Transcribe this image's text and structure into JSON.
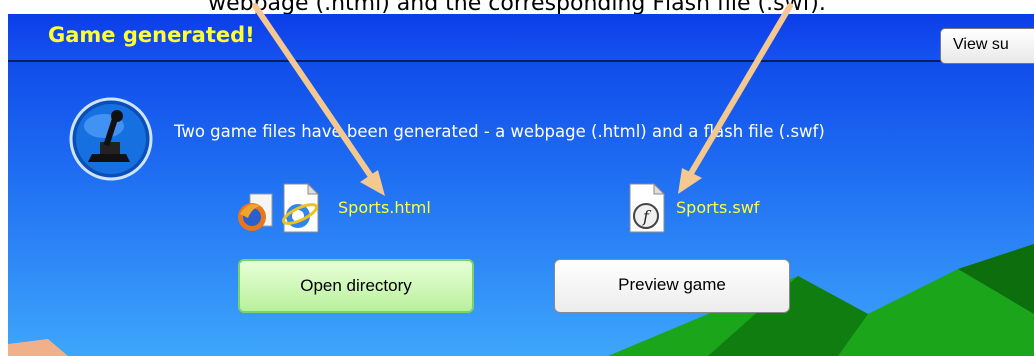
{
  "caption": "webpage (.html) and the corresponding Flash file (.swf).",
  "window": {
    "title": "Game generated!",
    "view_button_label": "View su"
  },
  "message": "Two game files have been generated - a webpage (.html) and a flash file (.swf)",
  "files": {
    "html_file": "Sports.html",
    "swf_file": "Sports.swf"
  },
  "buttons": {
    "open_directory": "Open directory",
    "preview_game": "Preview game"
  },
  "colors": {
    "title": "#ffff33",
    "link": "#ffff33",
    "background_top": "#0a3fe6",
    "background_bottom": "#3ea6fb",
    "arrow": "#f5c890",
    "hill": "#1aa51a"
  },
  "icons": [
    "joystick-icon",
    "firefox-icon",
    "internet-explorer-icon",
    "flash-file-icon"
  ]
}
